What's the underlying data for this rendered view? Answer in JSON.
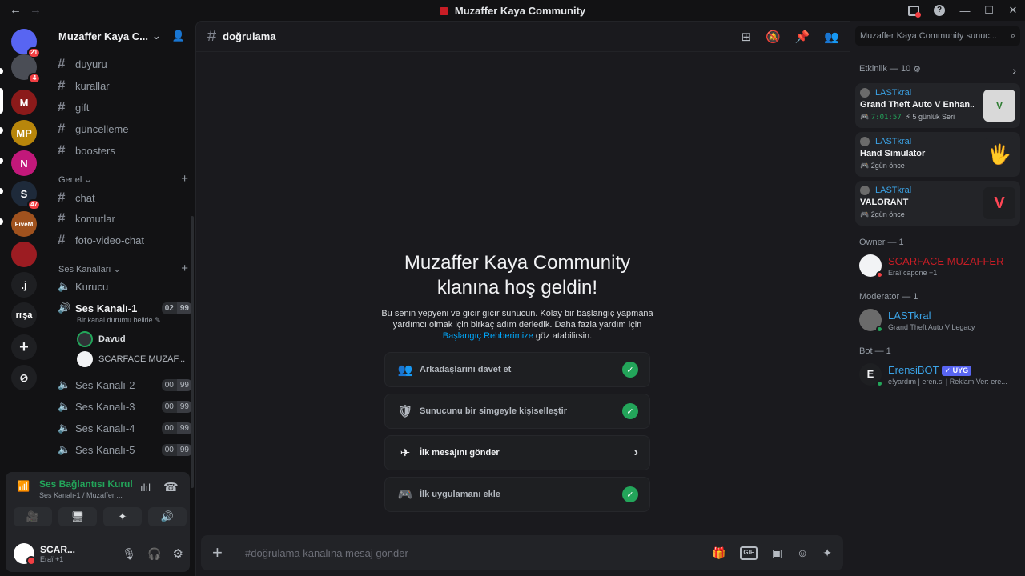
{
  "window": {
    "title": "Muzaffer Kaya Community",
    "back": "←",
    "forward": "→",
    "minimize": "—",
    "maximize": "☐",
    "close": "✕",
    "help": "?"
  },
  "rail": {
    "servers": [
      {
        "name": "direct-messages",
        "label": "",
        "badge": "21",
        "color": "#5865f2"
      },
      {
        "name": "server-1",
        "label": "",
        "badge": "4",
        "color": "#4a4d55"
      },
      {
        "name": "server-2",
        "label": "M",
        "badge": "",
        "color": "#8b1a1a"
      },
      {
        "name": "server-3",
        "label": "MP",
        "badge": "",
        "color": "#b8860b"
      },
      {
        "name": "server-4",
        "label": "N",
        "badge": "",
        "color": "#c2187a"
      },
      {
        "name": "server-5",
        "label": "S",
        "badge": "47",
        "color": "#1e2a3a"
      },
      {
        "name": "server-6",
        "label": "FiveM",
        "badge": "",
        "color": "#a0521e"
      },
      {
        "name": "server-7",
        "label": "",
        "badge": "",
        "color": "#9c1c22"
      },
      {
        "name": "server-8",
        "label": ".j",
        "badge": "",
        "color": "#1e1f22"
      },
      {
        "name": "server-9",
        "label": "rrşa",
        "badge": "",
        "color": "#1e1f22"
      }
    ],
    "add_server": "+",
    "discover": "⊘"
  },
  "sidebar": {
    "guild_name": "Muzaffer Kaya C...",
    "text_channels": [
      "duyuru",
      "kurallar",
      "gift",
      "güncelleme",
      "boosters"
    ],
    "category_general": "Genel",
    "general_channels": [
      "chat",
      "komutlar",
      "foto-video-chat"
    ],
    "category_voice": "Ses Kanalları",
    "voice_channels": [
      {
        "name": "Kurucu",
        "count": "",
        "limit": ""
      },
      {
        "name": "Ses Kanalı-1",
        "count": "02",
        "limit": "99"
      },
      {
        "name": "Ses Kanalı-2",
        "count": "00",
        "limit": "99"
      },
      {
        "name": "Ses Kanalı-3",
        "count": "00",
        "limit": "99"
      },
      {
        "name": "Ses Kanalı-4",
        "count": "00",
        "limit": "99"
      },
      {
        "name": "Ses Kanalı-5",
        "count": "00",
        "limit": "99"
      }
    ],
    "channel_status": "Bir kanal durumu belirle",
    "voice_users": [
      "Davud",
      "SCARFACE MUZAF..."
    ]
  },
  "voice_panel": {
    "status": "Ses Bağlantısı Kurul",
    "sub": "Ses Kanalı-1 / Muzaffer ...",
    "user_name": "SCAR...",
    "user_status": "Eraї +1"
  },
  "main": {
    "channel": "doğrulama",
    "welcome_title_1": "Muzaffer Kaya Community",
    "welcome_title_2": "klanına hoş geldin!",
    "welcome_body_1": "Bu senin yepyeni ve gıcır gıcır sunucun. Kolay bir başlangıç yapmana yardımcı olmak için birkaç adım derledik. Daha fazla yardım için",
    "welcome_link": "Başlangıç Rehberimize",
    "welcome_body_2": "göz atabilirsin.",
    "tasks": [
      {
        "label": "Arkadaşlarını davet et",
        "done": true
      },
      {
        "label": "Sunucunu bir simgeyle kişiselleştir",
        "done": true
      },
      {
        "label": "İlk mesajını gönder",
        "done": false
      },
      {
        "label": "İlk uygulamanı ekle",
        "done": true
      }
    ],
    "composer_placeholder": "#doğrulama kanalına mesaj gönder",
    "gif": "GIF"
  },
  "right": {
    "search_placeholder": "Muzaffer Kaya Community sunuc...",
    "activity_header": "Etkinlik — 10",
    "activities": [
      {
        "user": "LASTkral",
        "game": "Grand Theft Auto V Enhan...",
        "timer": "7:01:57",
        "streak": "5 günlük Seri",
        "time": ""
      },
      {
        "user": "LASTkral",
        "game": "Hand Simulator",
        "timer": "",
        "streak": "",
        "time": "2gün önce"
      },
      {
        "user": "LASTkral",
        "game": "VALORANT",
        "timer": "",
        "streak": "",
        "time": "2gün önce"
      }
    ],
    "owner_header": "Owner — 1",
    "owner_name": "SCARFACE MUZAFFER",
    "owner_status": "Eraї capone +1",
    "moderator_header": "Moderator — 1",
    "moderator_name": "LASTkral",
    "moderator_status": "Grand Theft Auto V Legacy",
    "bot_header": "Bot — 1",
    "bot_name": "ErensiBOT",
    "bot_tag": "✓ UYG",
    "bot_status": "e!yardım | eren.si | Reklam Ver: ere..."
  }
}
